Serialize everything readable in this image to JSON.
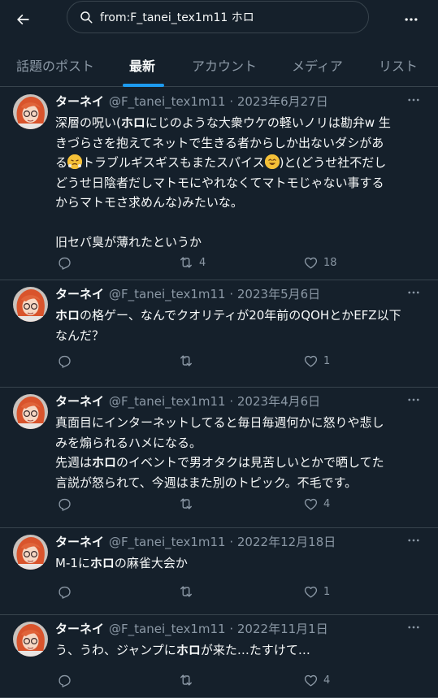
{
  "search": {
    "query": "from:F_tanei_tex1m11 ホロ"
  },
  "tabs": [
    "話題のポスト",
    "最新",
    "アカウント",
    "メディア",
    "リスト"
  ],
  "active_tab": "最新",
  "tweets": [
    {
      "name": "ターネイ",
      "meta": "@F_tanei_tex1m11 · 2023年6月27日",
      "lines": [
        "深層の呪い(ホロにじのような大衆ウケの軽いノリは勘弁w 生",
        "きづらさを抱えてネットで生きる者からしか出ないダシがあ",
        "る😤トラブルギスギスもまたスパイス😆)と(どうせ社不だし",
        "どうせ日陰者だしマトモにやれなくてマトモじゃない事する",
        "からマトモさ求めんな)みたいな。",
        "",
        "旧セパ臭が薄れたというか"
      ],
      "reply_count": "",
      "retweet_count": "4",
      "like_count": "18"
    },
    {
      "name": "ターネイ",
      "meta": "@F_tanei_tex1m11 · 2023年5月6日",
      "lines": [
        "ホロの格ゲー、なんでクオリティが20年前のQOHとかEFZ以下",
        "なんだ？"
      ],
      "reply_count": "",
      "retweet_count": "",
      "like_count": "1"
    },
    {
      "name": "ターネイ",
      "meta": "@F_tanei_tex1m11 · 2023年4月6日",
      "lines": [
        "真面目にインターネットしてると毎日毎週何かに怒りや悲し",
        "みを煽られるハメになる。",
        "先週はホロのイベントで男オタクは見苦しいとかで晒してた",
        "言説が怒られて、今週はまた別のトピック。不毛です。"
      ],
      "reply_count": "",
      "retweet_count": "",
      "like_count": "4"
    },
    {
      "name": "ターネイ",
      "meta": "@F_tanei_tex1m11 · 2022年12月18日",
      "lines": [
        "M-1にホロの麻雀大会か"
      ],
      "reply_count": "",
      "retweet_count": "",
      "like_count": "1"
    },
    {
      "name": "ターネイ",
      "meta": "@F_tanei_tex1m11 · 2022年11月1日",
      "lines": [
        "う、うわ、ジャンプにホロが来た…たすけて…"
      ],
      "reply_count": "",
      "retweet_count": "",
      "like_count": "4"
    }
  ],
  "colors": {
    "background": "#15202b",
    "accent": "#1d9bf0",
    "muted": "#8b98a5",
    "text": "#f7f9f9",
    "border": "#38444d"
  }
}
